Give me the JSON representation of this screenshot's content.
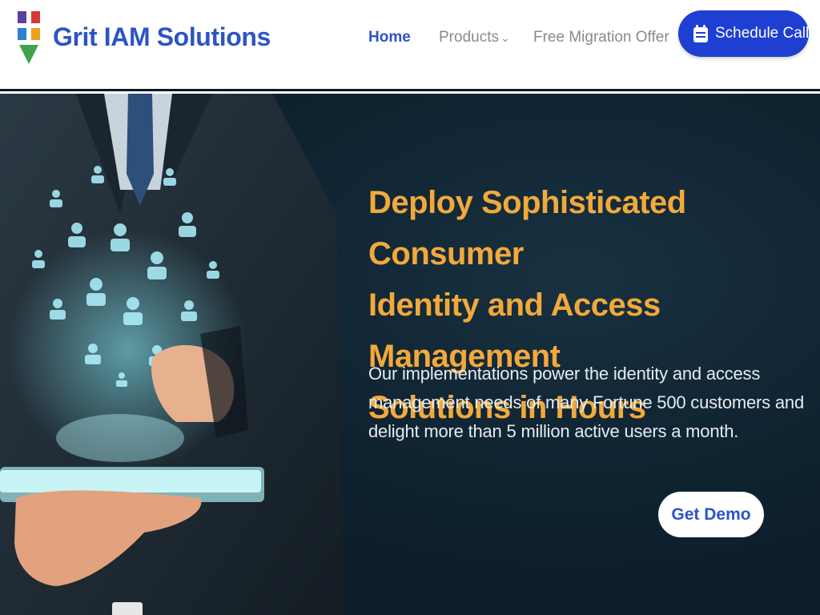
{
  "brand": {
    "name": "Grit IAM Solutions"
  },
  "nav": {
    "home": "Home",
    "products": "Products",
    "offer": "Free Migration Offer",
    "schedule_call": "Schedule Call"
  },
  "hero": {
    "title_lines": [
      "Deploy Sophisticated Consumer",
      "Identity and Access Management",
      "Solutions in Hours"
    ],
    "description_lines": [
      "Our implementations power the identity and access",
      "management needs of many Fortune 500 customers and",
      "delight more than 5 million active users a month."
    ],
    "demo_button": "Get Demo"
  },
  "colors": {
    "brand_blue": "#2e54c4",
    "cta_blue": "#1e3fd1",
    "headline_orange": "#f2a93b",
    "hero_bg": "#0f2230"
  },
  "icons": {
    "logo": "logo-mark-icon",
    "calendar": "calendar-icon",
    "chevron": "chevron-down-icon"
  }
}
